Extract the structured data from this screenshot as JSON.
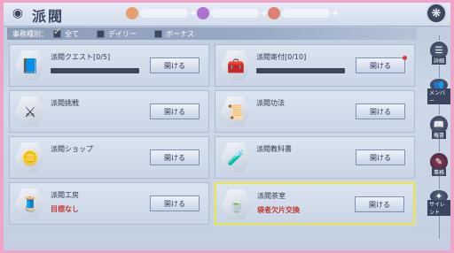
{
  "header": {
    "back_icon": "swirl-back-icon",
    "title": "派閥",
    "currencies": [
      {
        "icon": "coin-icon",
        "color": "#e8a070"
      },
      {
        "icon": "gem-icon",
        "color": "#b070d0"
      },
      {
        "icon": "ticket-icon",
        "color": "#e08070"
      }
    ],
    "top_right_icon": "swirl-icon"
  },
  "filter": {
    "label": "事務種別：",
    "options": [
      {
        "label": "全て",
        "checked": true
      },
      {
        "label": "デイリー",
        "checked": false
      },
      {
        "label": "ボーナス",
        "checked": false
      }
    ]
  },
  "cards": [
    {
      "name": "派閥クエスト[0/5]",
      "button": "開ける",
      "icon": "quest-book-icon",
      "has_bar": true,
      "progress": 0,
      "red_dot": false
    },
    {
      "name": "派閥寄付[0/10]",
      "button": "開ける",
      "icon": "donation-chest-icon",
      "has_bar": true,
      "progress": 0,
      "red_dot": true
    },
    {
      "name": "派閥挑戦",
      "button": "開ける",
      "icon": "crossed-swords-icon",
      "red_dot": false
    },
    {
      "name": "派閥功法",
      "button": "開ける",
      "icon": "scroll-icon",
      "red_dot": false
    },
    {
      "name": "派閥ショップ",
      "button": "開ける",
      "icon": "gold-ingot-icon",
      "red_dot": false
    },
    {
      "name": "派閥教科書",
      "button": "開ける",
      "icon": "potion-icon",
      "red_dot": false
    },
    {
      "name": "派閥工房",
      "sub": "目標なし",
      "button": "開ける",
      "icon": "workshop-icon",
      "red_dot": false
    },
    {
      "name": "派閥茶室",
      "sub": "袋者欠片交換",
      "button": "開ける",
      "icon": "tea-set-icon",
      "red_dot": false,
      "highlight": true
    }
  ],
  "side_menu": [
    {
      "label": "詳細",
      "icon": "details-icon"
    },
    {
      "label": "メンバー",
      "icon": "members-icon"
    },
    {
      "label": "権書",
      "icon": "book-icon"
    },
    {
      "label": "事務",
      "icon": "tasks-icon",
      "active": true
    },
    {
      "label": "サイレント",
      "icon": "silent-icon"
    }
  ]
}
